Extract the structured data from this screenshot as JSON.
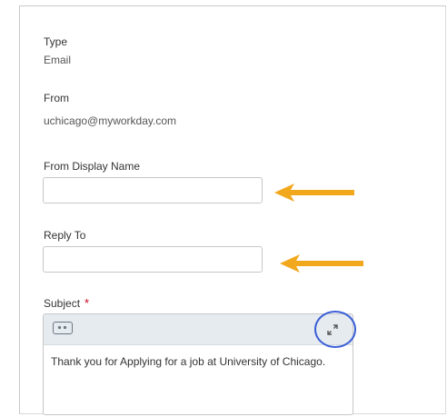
{
  "type_section": {
    "label": "Type",
    "value": "Email"
  },
  "from_section": {
    "label": "From",
    "value": "uchicago@myworkday.com"
  },
  "from_display_name": {
    "label": "From Display Name",
    "value": ""
  },
  "reply_to": {
    "label": "Reply To",
    "value": ""
  },
  "subject": {
    "label": "Subject",
    "required_marker": "*",
    "body_text": "Thank you for Applying for a job at University of Chicago."
  },
  "annotations": {
    "arrow_color": "#f2a81d",
    "highlight_ring_color": "#3b5fd6"
  },
  "icons": {
    "token": "prompt-token-icon",
    "expand": "expand-icon"
  }
}
